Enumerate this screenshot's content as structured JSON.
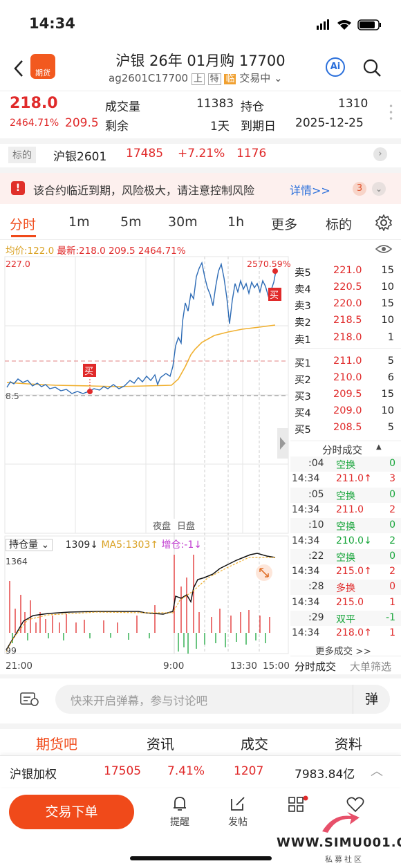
{
  "status_bar": {
    "time": "14:34"
  },
  "header": {
    "title": "沪银 26年 01月购 17700",
    "code": "ag2601C17700",
    "tags": [
      "上",
      "特",
      "临"
    ],
    "trade_status": "交易中",
    "logo_label": "期货",
    "ai_label": "Ai"
  },
  "quote": {
    "price": "218.0",
    "change_pct": "2464.71%",
    "change_abs": "209.5",
    "volume_label": "成交量",
    "volume": "11383",
    "oi_label": "持仓",
    "oi": "1310",
    "remain_label": "剩余",
    "remain": "1天",
    "expiry_label": "到期日",
    "expiry": "2025-12-25"
  },
  "underlying": {
    "label": "标的",
    "name": "沪银2601",
    "price": "17485",
    "change": "+7.21%",
    "change_abs": "1176"
  },
  "warning": {
    "text": "该合约临近到期，风险极大，请注意控制风险",
    "link": "详情>>",
    "count": "3"
  },
  "tabs": [
    "分时",
    "1m",
    "5m",
    "30m",
    "1h",
    "更多",
    "标的"
  ],
  "chart_header": {
    "avg": "均价:122.0",
    "latest": "最新:218.0  209.5  2464.71%"
  },
  "chart_labels": {
    "top_left": "227.0",
    "top_right": "2570.59%",
    "bottom_left": "8.5",
    "buy_tag": "买",
    "night": "夜盘",
    "day": "日盘"
  },
  "oi_panel": {
    "selector": "持仓量",
    "current": "1309↓",
    "ma5": "MA5:1303↑",
    "delta": "增仓:-1↓",
    "top": "1364",
    "bottom": "99"
  },
  "x_axis": [
    "21:00",
    "9:00",
    "13:30",
    "15:00"
  ],
  "order_book": {
    "asks": [
      {
        "label": "卖5",
        "price": "221.0",
        "vol": "15"
      },
      {
        "label": "卖4",
        "price": "220.5",
        "vol": "10"
      },
      {
        "label": "卖3",
        "price": "220.0",
        "vol": "15"
      },
      {
        "label": "卖2",
        "price": "218.5",
        "vol": "10"
      },
      {
        "label": "卖1",
        "price": "218.0",
        "vol": "1"
      }
    ],
    "bids": [
      {
        "label": "买1",
        "price": "211.0",
        "vol": "5"
      },
      {
        "label": "买2",
        "price": "210.0",
        "vol": "6"
      },
      {
        "label": "买3",
        "price": "209.5",
        "vol": "15"
      },
      {
        "label": "买4",
        "price": "209.0",
        "vol": "10"
      },
      {
        "label": "买5",
        "price": "208.5",
        "vol": "5"
      }
    ]
  },
  "trades_header": "分时成交",
  "trades": [
    {
      "t": ":04",
      "p": "空换",
      "v": "0",
      "c": "green"
    },
    {
      "t": "14:34",
      "p": "211.0↑",
      "v": "3",
      "c": "red"
    },
    {
      "t": ":05",
      "p": "空换",
      "v": "0",
      "c": "green"
    },
    {
      "t": "14:34",
      "p": "211.0",
      "v": "2",
      "c": "red"
    },
    {
      "t": ":10",
      "p": "空换",
      "v": "0",
      "c": "green"
    },
    {
      "t": "14:34",
      "p": "210.0↓",
      "v": "2",
      "c": "green"
    },
    {
      "t": ":22",
      "p": "空换",
      "v": "0",
      "c": "green"
    },
    {
      "t": "14:34",
      "p": "215.0↑",
      "v": "2",
      "c": "red"
    },
    {
      "t": ":28",
      "p": "多换",
      "v": "0",
      "c": "red"
    },
    {
      "t": "14:34",
      "p": "215.0",
      "v": "1",
      "c": "red"
    },
    {
      "t": ":29",
      "p": "双平",
      "v": "-1",
      "c": "green"
    },
    {
      "t": "14:34",
      "p": "218.0↑",
      "v": "1",
      "c": "red"
    }
  ],
  "trades_more": "更多成交 >>",
  "panel_tabs": [
    "分时成交",
    "大单筛选"
  ],
  "comment": {
    "placeholder": "快来开启弹幕，参与讨论吧",
    "danmu": "弹"
  },
  "bottom_tabs": [
    "期货吧",
    "资讯",
    "成交",
    "资料"
  ],
  "weighted": {
    "name": "沪银加权",
    "price": "17505",
    "change": "7.41%",
    "abs": "1207",
    "amount": "7983.84亿"
  },
  "actions": {
    "trade": "交易下单",
    "remind": "提醒",
    "post": "发帖"
  },
  "watermark": {
    "site": "WWW.SIMU001.CN",
    "sub": "私募社区"
  },
  "colors": {
    "up": "#e02a2a",
    "down": "#17a53a",
    "accent": "#f04a1a",
    "price_line": "#2d6bb5",
    "avg_line": "#f0b030"
  }
}
